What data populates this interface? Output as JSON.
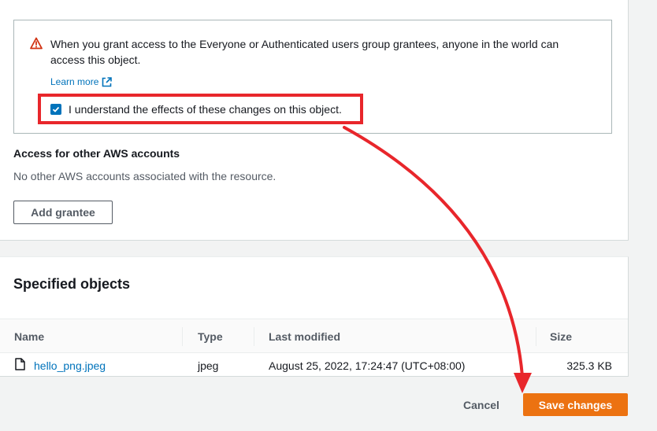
{
  "warning": {
    "text": "When you grant access to the Everyone or Authenticated users group grantees, anyone in the world can access this object.",
    "learn_more": "Learn more",
    "checkbox_label": "I understand the effects of these changes on this object.",
    "checkbox_checked": true
  },
  "other_accounts": {
    "title": "Access for other AWS accounts",
    "description": "No other AWS accounts associated with the resource.",
    "add_button": "Add grantee"
  },
  "objects": {
    "title": "Specified objects",
    "columns": [
      "Name",
      "Type",
      "Last modified",
      "Size"
    ],
    "rows": [
      {
        "name": "hello_png.jpeg",
        "type": "jpeg",
        "last_modified": "August 25, 2022, 17:24:47 (UTC+08:00)",
        "size": "325.3 KB"
      }
    ]
  },
  "footer": {
    "cancel": "Cancel",
    "save": "Save changes"
  },
  "colors": {
    "link": "#0073bb",
    "primary": "#ec7211",
    "warning_icon": "#d13212",
    "annotation": "#e8262b"
  },
  "icons": {
    "warning": "warning-triangle-icon",
    "external": "external-link-icon",
    "file": "file-icon",
    "check": "checkmark-icon"
  }
}
